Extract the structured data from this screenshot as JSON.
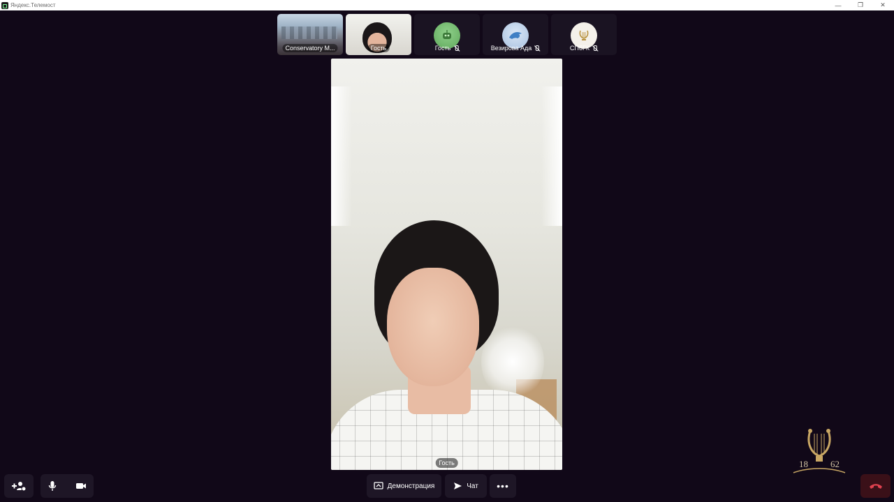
{
  "window": {
    "title": "Яндекс.Телемост",
    "controls": [
      "minimize",
      "restore",
      "close"
    ]
  },
  "participants": [
    {
      "name": "Conservatory M...",
      "type": "video",
      "muted": false
    },
    {
      "name": "Гость",
      "type": "video",
      "muted": false
    },
    {
      "name": "Гость",
      "type": "avatar",
      "avatar_icon": "robot-avatar-icon",
      "avatar_color": "#6fbf6a",
      "muted": true
    },
    {
      "name": "Везирова Ада",
      "type": "avatar",
      "avatar_icon": "dolphin-avatar-icon",
      "avatar_color": "#b7cbe6",
      "muted": true
    },
    {
      "name": "СПбГК",
      "type": "avatar",
      "avatar_icon": "lyre-logo-icon",
      "avatar_color": "#f4f1ea",
      "muted": true
    }
  ],
  "main_video": {
    "participant_label": "Гость"
  },
  "toolbar": {
    "invite_icon": "add-participant-icon",
    "mic_icon": "microphone-icon",
    "camera_icon": "camera-icon",
    "screen_share_label": "Демонстрация",
    "chat_label": "Чат",
    "more_icon": "more-dots-icon",
    "end_call_icon": "hang-up-icon"
  },
  "watermark": {
    "year_left": "18",
    "year_right": "62"
  },
  "colors": {
    "background": "#110818",
    "button_bg": "#1e1626",
    "end_call_bg": "#3a1018",
    "end_call_icon": "#e0424f",
    "logo_gold": "#c9a764"
  }
}
